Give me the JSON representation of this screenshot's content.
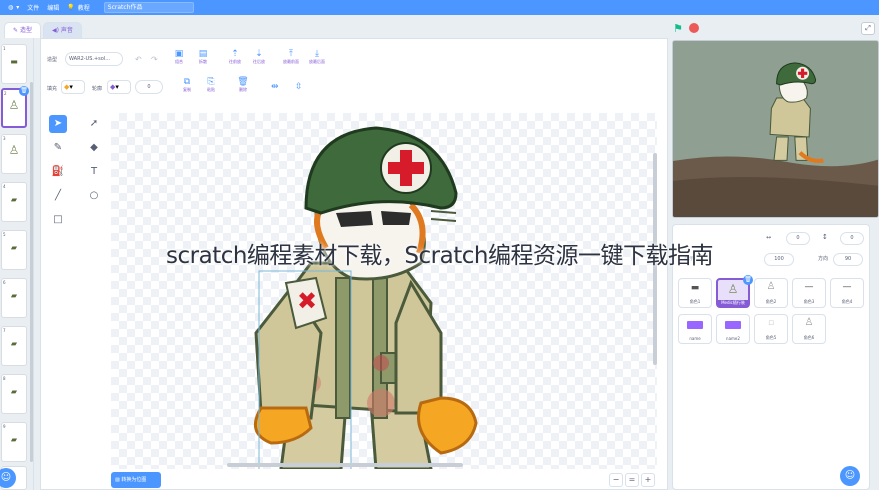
{
  "menubar": {
    "globe_icon": "globe-icon",
    "file_label": "文件",
    "edit_label": "编辑",
    "tutorials_label": "教程",
    "project_title": "Scratch作品"
  },
  "tabs": [
    {
      "label": "造型",
      "icon": "brush-icon"
    },
    {
      "label": "声音",
      "icon": "speaker-icon"
    }
  ],
  "sidebar": {
    "thumbs": [
      {
        "num": "1",
        "label": "ib...\nsol"
      },
      {
        "num": "2",
        "label": "...",
        "selected": true
      },
      {
        "num": "3",
        "label": "...\nsol"
      },
      {
        "num": "4",
        "label": "...\nsol"
      },
      {
        "num": "5",
        "label": "...\nsol"
      },
      {
        "num": "6",
        "label": "...\nsol"
      },
      {
        "num": "7",
        "label": "...\nsol"
      },
      {
        "num": "8",
        "label": "...\nsol"
      },
      {
        "num": "9",
        "label": "...\nsol"
      },
      {
        "num": "10",
        "label": "...\nsol"
      }
    ]
  },
  "toolbar": {
    "costume_label": "造型",
    "costume_name": "WAR2-US.+sol...",
    "fill_label": "填充",
    "outline_label": "轮廓",
    "outline_width": "0",
    "buttons": [
      "组合",
      "拆散",
      "往前放",
      "往后放",
      "放最前面",
      "放最后面"
    ],
    "copy_label": "复制",
    "paste_label": "粘贴",
    "delete_label": "删除"
  },
  "footer": {
    "bitmap_label": "转换为位图",
    "zoom_out": "−",
    "zoom_reset": "=",
    "zoom_in": "+"
  },
  "sprite_info": {
    "x": "0",
    "y": "0",
    "show_label": "显示",
    "size": "100",
    "direction_label": "方向",
    "direction": "90"
  },
  "sprites": [
    {
      "label": "角色1"
    },
    {
      "label": "Medic随行装",
      "selected": true
    },
    {
      "label": "角色2"
    },
    {
      "label": "角色3"
    },
    {
      "label": "角色4"
    },
    {
      "label": "name"
    },
    {
      "label": "name2"
    },
    {
      "label": "角色5"
    },
    {
      "label": "角色6"
    }
  ],
  "overlay": {
    "title": "scratch编程素材下载，Scratch编程资源一键下载指南"
  },
  "colors": {
    "accent": "#4c97ff",
    "selection": "#855cd6"
  }
}
